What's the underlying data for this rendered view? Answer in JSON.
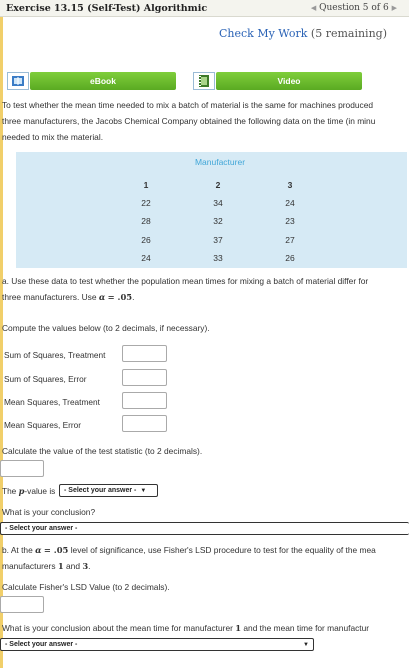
{
  "header": {
    "title": "Exercise 13.15 (Self-Test) Algorithmic",
    "question_nav": "Question 5 of 6",
    "prev_arrow": "◀",
    "next_arrow": "▶"
  },
  "check_my_work": {
    "link": "Check My Work",
    "remaining": "(5 remaining)"
  },
  "resources": {
    "ebook_label": "eBook",
    "video_label": "Video"
  },
  "intro": [
    "To test whether the mean time needed to mix a batch of material is the same for machines produced",
    "three manufacturers, the Jacobs Chemical Company obtained the following data on the time (in minu",
    "needed to mix the material."
  ],
  "table": {
    "caption": "Manufacturer",
    "columns": [
      "1",
      "2",
      "3"
    ],
    "rows": [
      [
        "22",
        "34",
        "24"
      ],
      [
        "28",
        "32",
        "23"
      ],
      [
        "26",
        "37",
        "27"
      ],
      [
        "24",
        "33",
        "26"
      ]
    ]
  },
  "part_a": {
    "line1": "a. Use these data to test whether the population mean times for mixing a batch of material differ for",
    "line2_pre": "three manufacturers. Use",
    "alpha_sym": "α",
    "alpha_eq": "= .05",
    "line2_post": ".",
    "compute": "Compute the values below (to 2 decimals, if necessary).",
    "fields": [
      {
        "label": "Sum of Squares, Treatment",
        "value": ""
      },
      {
        "label": "Sum of Squares, Error",
        "value": ""
      },
      {
        "label": "Mean Squares, Treatment",
        "value": ""
      },
      {
        "label": "Mean Squares, Error",
        "value": ""
      }
    ],
    "test_stat": "Calculate the value of the test statistic (to 2 decimals).",
    "pvalue_pre": "The",
    "pvalue_sym": "p",
    "pvalue_post": "-value is",
    "pvalue_select": "- Select your answer -",
    "conclusion": "What is your conclusion?",
    "conclusion_select": "- Select your answer -"
  },
  "part_b": {
    "line1_pre": "b. At the",
    "alpha_sym": "α",
    "alpha_eq": "= .05",
    "line1_post": "level of significance, use Fisher's LSD procedure to test for the equality of the mea",
    "line2_pre": "manufacturers",
    "m1": "1",
    "and": "and",
    "m3": "3",
    "line2_post": ".",
    "lsd": "Calculate Fisher's LSD Value (to 2 decimals).",
    "conc_pre": "What is your conclusion about the mean time for manufacturer",
    "conc_m": "1",
    "conc_post": "and the mean time for manufactur",
    "conc_select": "- Select your answer -"
  }
}
